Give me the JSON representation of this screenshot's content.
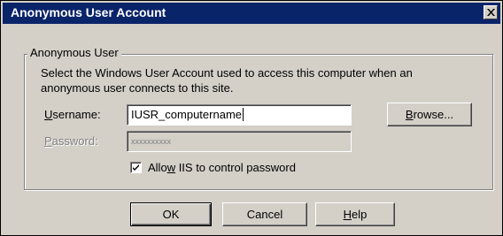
{
  "window": {
    "title": "Anonymous User Account",
    "close_icon": "close-icon"
  },
  "group": {
    "legend": "Anonymous User",
    "description": "Select the Windows User Account used to access this computer when an anonymous user connects to this site."
  },
  "username": {
    "label_prefix": "",
    "label_accel": "U",
    "label_rest": "sername:",
    "value": "IUSR_computername"
  },
  "password": {
    "label_prefix": "",
    "label_accel": "P",
    "label_rest": "assword:",
    "value": "xxxxxxxxxx",
    "enabled": false
  },
  "browse_button": {
    "accel": "B",
    "rest": "rowse..."
  },
  "allow_iis_checkbox": {
    "checked": true,
    "label_prefix": "Allo",
    "label_accel": "w",
    "label_rest": " IIS to control password"
  },
  "buttons": {
    "ok": "OK",
    "cancel": "Cancel",
    "help_accel": "H",
    "help_rest": "elp"
  },
  "colors": {
    "titlebar": "#0a246a",
    "face": "#d4d0c8"
  }
}
